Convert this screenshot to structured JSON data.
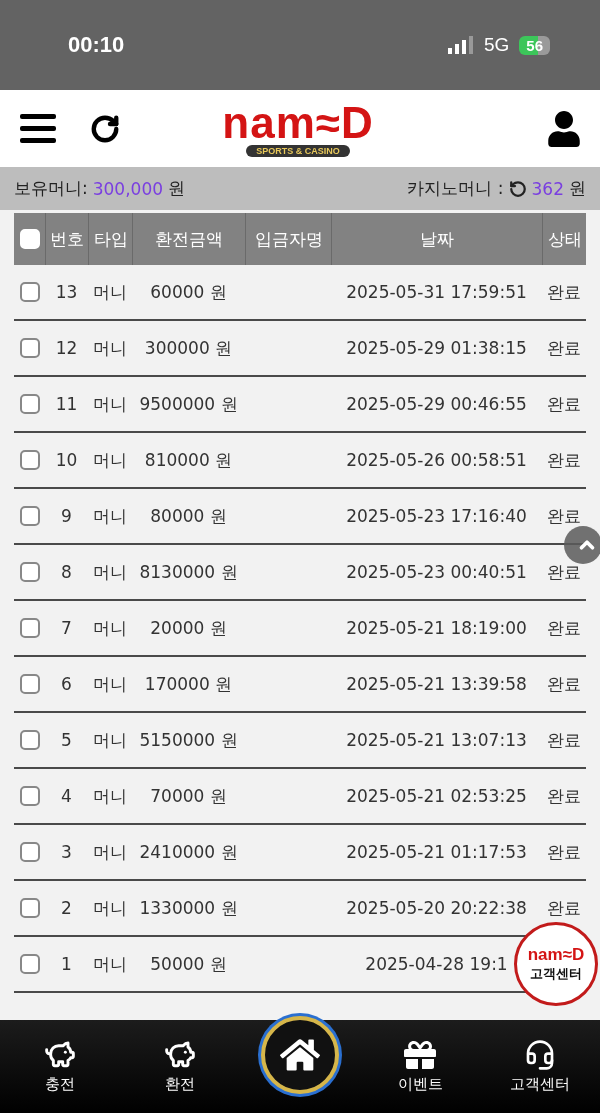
{
  "status_bar": {
    "time": "00:10",
    "network": "5G",
    "battery": "56"
  },
  "header": {
    "logo": "nam≈D",
    "logo_tagline": "SPORTS & CASINO"
  },
  "balance": {
    "label": "보유머니:",
    "amount": "300,000",
    "unit": "원",
    "casino_label": "카지노머니 :",
    "casino_amount": "362",
    "casino_unit": "원"
  },
  "table": {
    "select_all": {
      "checked": false
    },
    "columns": [
      "번호",
      "타입",
      "환전금액",
      "입금자명",
      "날짜",
      "상태"
    ],
    "rows": [
      {
        "checked": false,
        "no": "13",
        "type": "머니",
        "amount": "60000 원",
        "date": "2025-05-31 17:59:51",
        "status": "완료"
      },
      {
        "checked": false,
        "no": "12",
        "type": "머니",
        "amount": "300000 원",
        "date": "2025-05-29 01:38:15",
        "status": "완료"
      },
      {
        "checked": false,
        "no": "11",
        "type": "머니",
        "amount": "9500000 원",
        "date": "2025-05-29 00:46:55",
        "status": "완료"
      },
      {
        "checked": false,
        "no": "10",
        "type": "머니",
        "amount": "810000 원",
        "date": "2025-05-26 00:58:51",
        "status": "완료"
      },
      {
        "checked": false,
        "no": "9",
        "type": "머니",
        "amount": "80000 원",
        "date": "2025-05-23 17:16:40",
        "status": "완료"
      },
      {
        "checked": false,
        "no": "8",
        "type": "머니",
        "amount": "8130000 원",
        "date": "2025-05-23 00:40:51",
        "status": "완료"
      },
      {
        "checked": false,
        "no": "7",
        "type": "머니",
        "amount": "20000 원",
        "date": "2025-05-21 18:19:00",
        "status": "완료"
      },
      {
        "checked": false,
        "no": "6",
        "type": "머니",
        "amount": "170000 원",
        "date": "2025-05-21 13:39:58",
        "status": "완료"
      },
      {
        "checked": false,
        "no": "5",
        "type": "머니",
        "amount": "5150000 원",
        "date": "2025-05-21 13:07:13",
        "status": "완료"
      },
      {
        "checked": false,
        "no": "4",
        "type": "머니",
        "amount": "70000 원",
        "date": "2025-05-21 02:53:25",
        "status": "완료"
      },
      {
        "checked": false,
        "no": "3",
        "type": "머니",
        "amount": "2410000 원",
        "date": "2025-05-21 01:17:53",
        "status": "완료"
      },
      {
        "checked": false,
        "no": "2",
        "type": "머니",
        "amount": "1330000 원",
        "date": "2025-05-20 20:22:38",
        "status": "완료"
      },
      {
        "checked": false,
        "no": "1",
        "type": "머니",
        "amount": "50000 원",
        "date": "2025-04-28 19:1",
        "status": ""
      }
    ]
  },
  "support_badge": {
    "logo": "nam≈D",
    "label": "고객센터"
  },
  "bottom_nav": [
    {
      "kind": "deposit",
      "label": "충전"
    },
    {
      "kind": "withdraw",
      "label": "환전"
    },
    {
      "kind": "home"
    },
    {
      "kind": "event",
      "label": "이벤트"
    },
    {
      "kind": "support",
      "label": "고객센터"
    }
  ]
}
